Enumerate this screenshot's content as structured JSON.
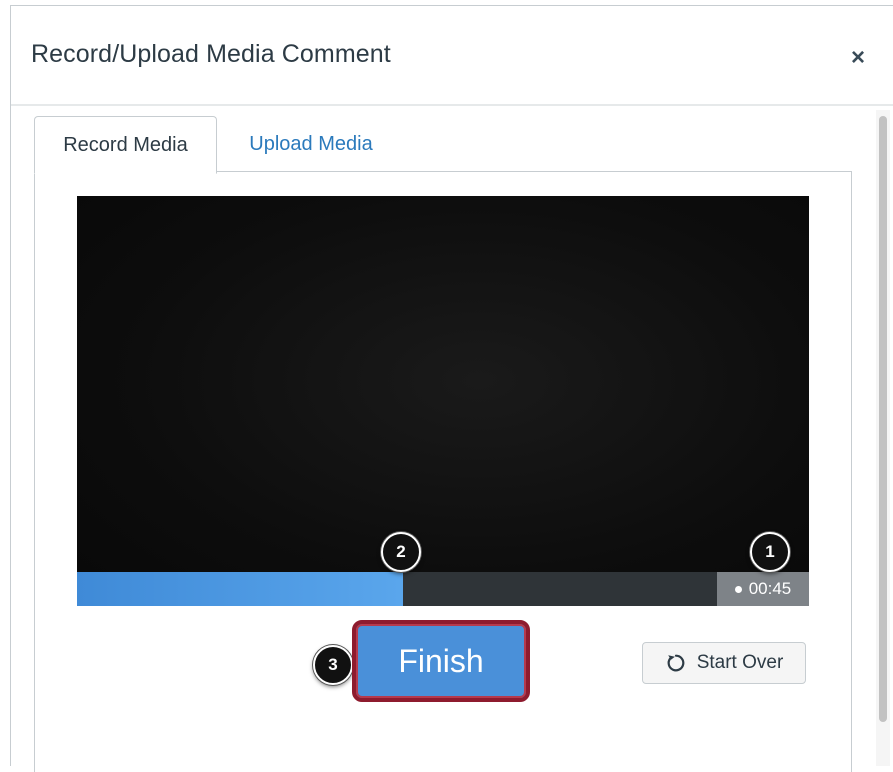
{
  "dialog": {
    "title": "Record/Upload Media Comment",
    "close_glyph": "×"
  },
  "tabs": [
    {
      "label": "Record Media",
      "active": true
    },
    {
      "label": "Upload Media",
      "active": false
    }
  ],
  "recorder": {
    "progress_fraction": 0.445,
    "timer": "00:45",
    "callouts": [
      "1",
      "2",
      "3"
    ]
  },
  "buttons": {
    "finish": "Finish",
    "start_over": "Start Over"
  },
  "icons": {
    "close": "close-icon",
    "reload": "reload-icon",
    "recording": "recording-dot-icon"
  },
  "colors": {
    "accent": "#2b7abc",
    "finish_button": "#4a90d9",
    "highlight_border": "#8e1b2e",
    "progress": "#4a90d9"
  }
}
